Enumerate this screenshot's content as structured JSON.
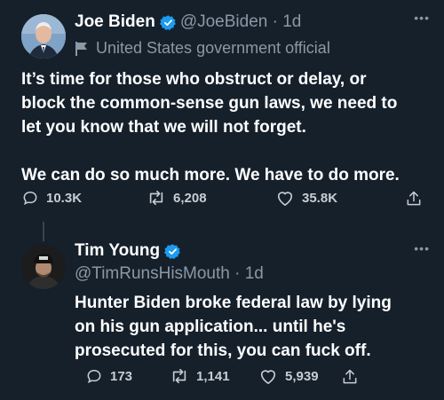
{
  "tweets": [
    {
      "name": "Joe Biden",
      "handle": "@JoeBiden · 1d",
      "gov_label": "United States government official",
      "lines": [
        "It’s time for those who obstruct or delay, or",
        "block the common-sense gun laws, we need to",
        "let you know that we will not forget.",
        "",
        "We can do so much more. We have to do more."
      ],
      "replies": "10.3K",
      "retweets": "6,208",
      "likes": "35.8K"
    },
    {
      "name": "Tim Young",
      "handle": "@TimRunsHisMouth · 1d",
      "lines": [
        "Hunter Biden broke federal law by lying",
        "on his gun application... until he's",
        "prosecuted for this, you can fuck off."
      ],
      "replies": "173",
      "retweets": "1,141",
      "likes": "5,939"
    }
  ],
  "colors": {
    "background": "#15202b",
    "text": "#ffffff",
    "secondary": "#8b98a5",
    "verified": "#1d9bf0"
  }
}
